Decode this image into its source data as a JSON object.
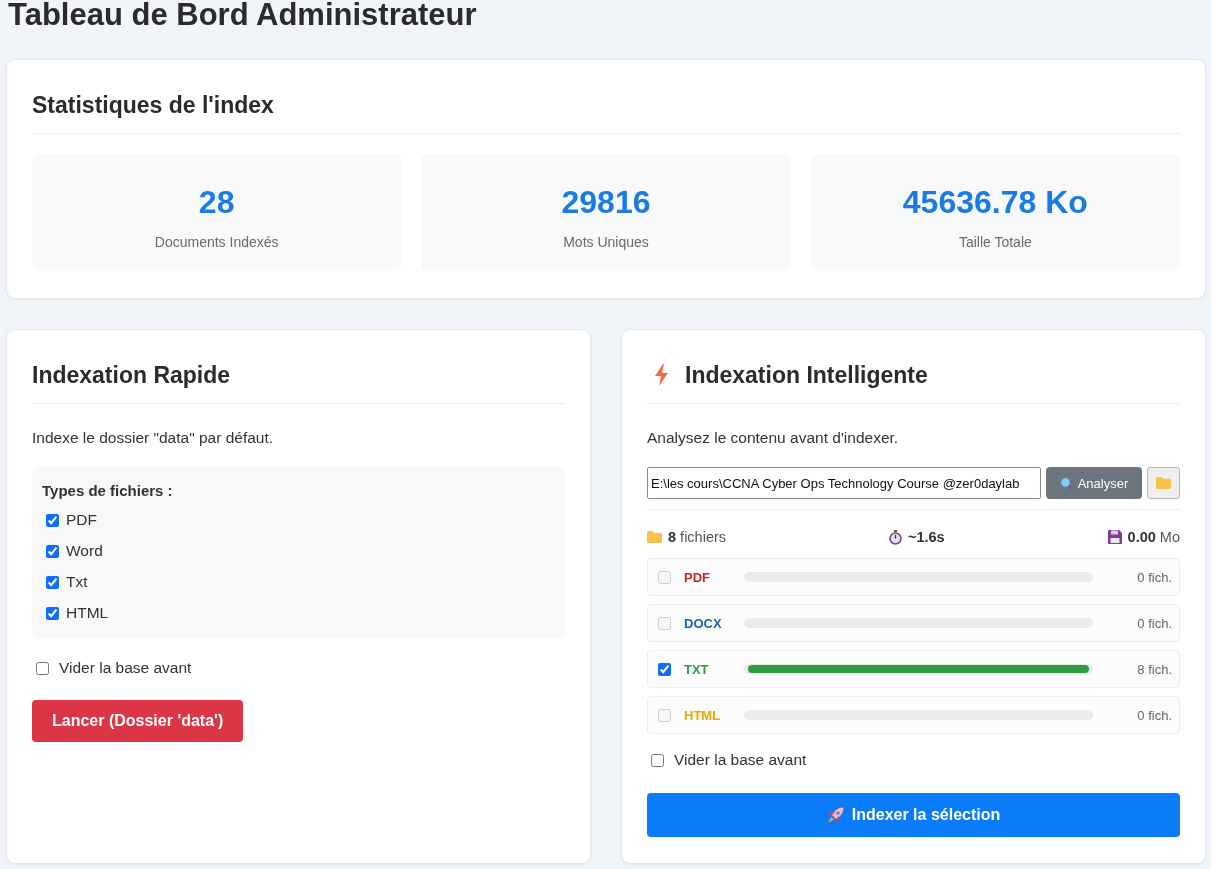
{
  "page_title": "Tableau de Bord Administrateur",
  "stats_card": {
    "title": "Statistiques de l'index",
    "stats": [
      {
        "value": "28",
        "label": "Documents Indexés"
      },
      {
        "value": "29816",
        "label": "Mots Uniques"
      },
      {
        "value": "45636.78 Ko",
        "label": "Taille Totale"
      }
    ]
  },
  "quick_indexing": {
    "title": "Indexation Rapide",
    "description": "Indexe le dossier \"data\" par défaut.",
    "file_types_label": "Types de fichiers :",
    "file_types": [
      {
        "label": "PDF",
        "checked": true
      },
      {
        "label": "Word",
        "checked": true
      },
      {
        "label": "Txt",
        "checked": true
      },
      {
        "label": "HTML",
        "checked": true
      }
    ],
    "clear_option": {
      "label": "Vider la base avant",
      "checked": false
    },
    "launch_button": "Lancer (Dossier 'data')"
  },
  "smart_indexing": {
    "title": "Indexation Intelligente",
    "description": "Analysez le contenu avant d'indexer.",
    "path_input": {
      "value": "E:\\les cours\\CCNA Cyber Ops Technology Course @zer0daylab"
    },
    "analyze_button": "Analyser",
    "summary": {
      "files": "**8** fichiers",
      "time": "~1.6s",
      "size": "**0.00** Mo"
    },
    "types": [
      {
        "label": "PDF",
        "checked": false,
        "disabled": true,
        "level": 0,
        "count": "0 fich.",
        "color": "#c62828"
      },
      {
        "label": "DOCX",
        "checked": false,
        "disabled": true,
        "level": 0,
        "count": "0 fich.",
        "color": "#1565c0"
      },
      {
        "label": "TXT",
        "checked": true,
        "disabled": false,
        "level": 1,
        "count": "8 fich.",
        "color": "#2e9b45"
      },
      {
        "label": "HTML",
        "checked": false,
        "disabled": true,
        "level": 0,
        "count": "0 fich.",
        "color": "#f0a500"
      }
    ],
    "clear_option": {
      "label": "Vider la base avant",
      "checked": false
    },
    "index_button": "Indexer la sélection"
  }
}
